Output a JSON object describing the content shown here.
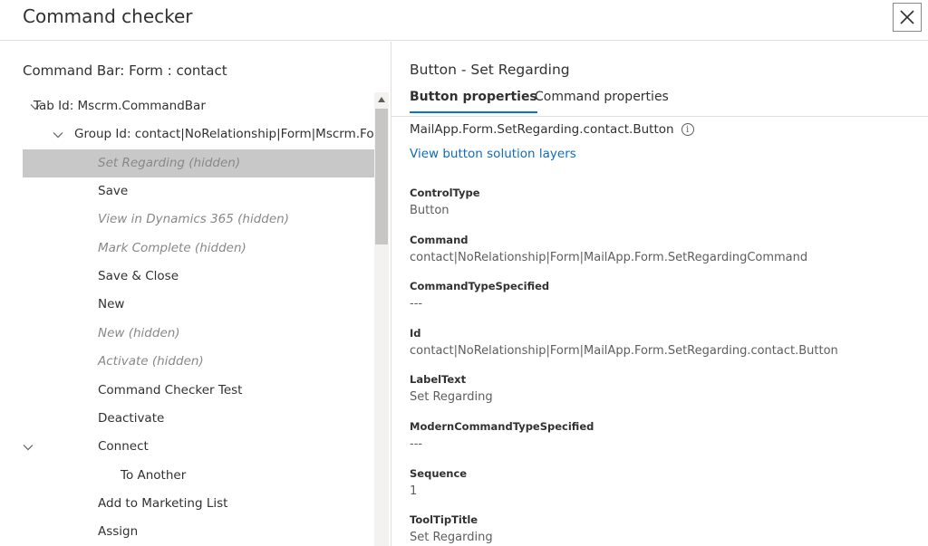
{
  "dialog": {
    "title": "Command checker",
    "close_label": "close"
  },
  "left": {
    "heading": "Command Bar: Form : contact",
    "tree": [
      {
        "label": "Tab Id: Mscrm.CommandBar",
        "indent": 0,
        "expanded": true,
        "selected": false,
        "hidden": false
      },
      {
        "label": "Group Id: contact|NoRelationship|Form|Mscrm.Form.contact.MainTab",
        "indent": 1,
        "expanded": true,
        "selected": false,
        "hidden": false
      },
      {
        "label": "Set Regarding (hidden)",
        "indent": 2,
        "selected": true,
        "hidden": true
      },
      {
        "label": "Save",
        "indent": 2,
        "selected": false,
        "hidden": false
      },
      {
        "label": "View in Dynamics 365 (hidden)",
        "indent": 2,
        "selected": false,
        "hidden": true
      },
      {
        "label": "Mark Complete (hidden)",
        "indent": 2,
        "selected": false,
        "hidden": true
      },
      {
        "label": "Save & Close",
        "indent": 2,
        "selected": false,
        "hidden": false
      },
      {
        "label": "New",
        "indent": 2,
        "selected": false,
        "hidden": false
      },
      {
        "label": "New (hidden)",
        "indent": 2,
        "selected": false,
        "hidden": true
      },
      {
        "label": "Activate (hidden)",
        "indent": 2,
        "selected": false,
        "hidden": true
      },
      {
        "label": "Command Checker Test",
        "indent": 2,
        "selected": false,
        "hidden": false
      },
      {
        "label": "Deactivate",
        "indent": 2,
        "selected": false,
        "hidden": false
      },
      {
        "label": "Connect",
        "indent": 2,
        "expanded": true,
        "selected": false,
        "hidden": false
      },
      {
        "label": "To Another",
        "indent": 3,
        "selected": false,
        "hidden": false
      },
      {
        "label": "Add to Marketing List",
        "indent": 2,
        "selected": false,
        "hidden": false
      },
      {
        "label": "Assign",
        "indent": 2,
        "selected": false,
        "hidden": false
      }
    ]
  },
  "right": {
    "heading": "Button - Set Regarding",
    "tabs": [
      {
        "label": "Button properties",
        "active": true
      },
      {
        "label": "Command properties",
        "active": false
      }
    ],
    "button_id": "MailApp.Form.SetRegarding.contact.Button",
    "layers_link": "View button solution layers",
    "properties": [
      {
        "label": "ControlType",
        "value": "Button"
      },
      {
        "label": "Command",
        "value": "contact|NoRelationship|Form|MailApp.Form.SetRegardingCommand"
      },
      {
        "label": "CommandTypeSpecified",
        "value": "---"
      },
      {
        "label": "Id",
        "value": "contact|NoRelationship|Form|MailApp.Form.SetRegarding.contact.Button"
      },
      {
        "label": "LabelText",
        "value": "Set Regarding"
      },
      {
        "label": "ModernCommandTypeSpecified",
        "value": "---"
      },
      {
        "label": "Sequence",
        "value": "1"
      },
      {
        "label": "ToolTipTitle",
        "value": "Set Regarding"
      }
    ]
  },
  "colors": {
    "accent": "#0078d4",
    "link": "#0f6cbd",
    "selected_row": "#c8c8c8",
    "hidden_text": "#8a8886"
  }
}
